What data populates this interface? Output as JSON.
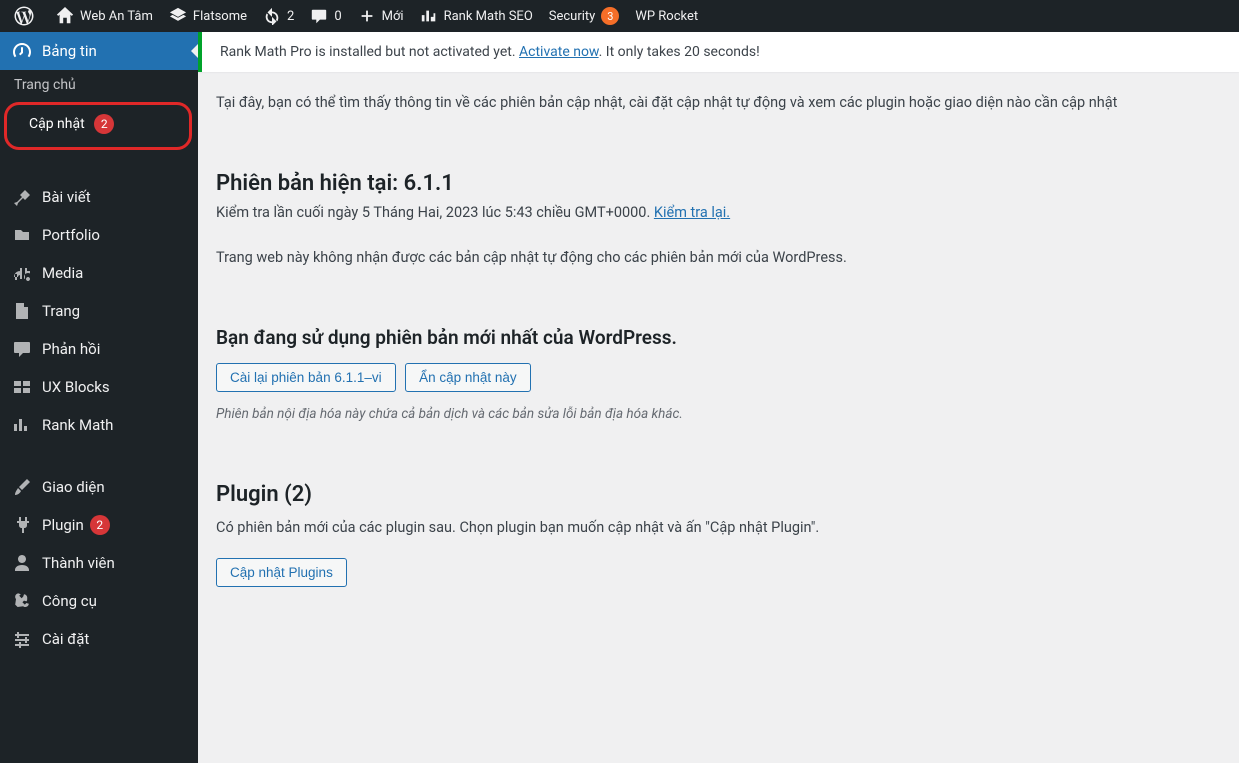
{
  "topbar": {
    "site": "Web An Tâm",
    "flatsome": "Flatsome",
    "updates": "2",
    "comments": "0",
    "new": "Mới",
    "rankmath": "Rank Math SEO",
    "security": "Security",
    "security_badge": "3",
    "wprocket": "WP Rocket"
  },
  "sidebar": {
    "dashboard": "Bảng tin",
    "home": "Trang chủ",
    "updates": "Cập nhật",
    "updates_badge": "2",
    "posts": "Bài viết",
    "portfolio": "Portfolio",
    "media": "Media",
    "pages": "Trang",
    "comments": "Phản hồi",
    "uxblocks": "UX Blocks",
    "rankmath": "Rank Math",
    "appearance": "Giao diện",
    "plugins": "Plugin",
    "plugins_badge": "2",
    "users": "Thành viên",
    "tools": "Công cụ",
    "settings": "Cài đặt"
  },
  "notice": {
    "pre": "Rank Math Pro is installed but not activated yet. ",
    "link": "Activate now",
    "post": ". It only takes 20 seconds!"
  },
  "content": {
    "intro": "Tại đây, bạn có thể tìm thấy thông tin về các phiên bản cập nhật, cài đặt cập nhật tự động và xem các plugin hoặc giao diện nào cần cập nhật",
    "current_heading": "Phiên bản hiện tại: 6.1.1",
    "check_text": "Kiểm tra lần cuối ngày 5 Tháng Hai, 2023 lúc 5:43 chiều GMT+0000. ",
    "check_link": "Kiểm tra lại.",
    "auto_text": "Trang web này không nhận được các bản cập nhật tự động cho các phiên bản mới của WordPress.",
    "latest_heading": "Bạn đang sử dụng phiên bản mới nhất của WordPress.",
    "btn_reinstall": "Cài lại phiên bản 6.1.1–vi",
    "btn_hide": "Ẩn cập nhật này",
    "italic": "Phiên bản nội địa hóa này chứa cả bản dịch và các bản sửa lỗi bản địa hóa khác.",
    "plugin_heading": "Plugin (2)",
    "plugin_text": "Có phiên bản mới của các plugin sau. Chọn plugin bạn muốn cập nhật và ấn \"Cập nhật Plugin\".",
    "btn_update_plugins": "Cập nhật Plugins"
  }
}
